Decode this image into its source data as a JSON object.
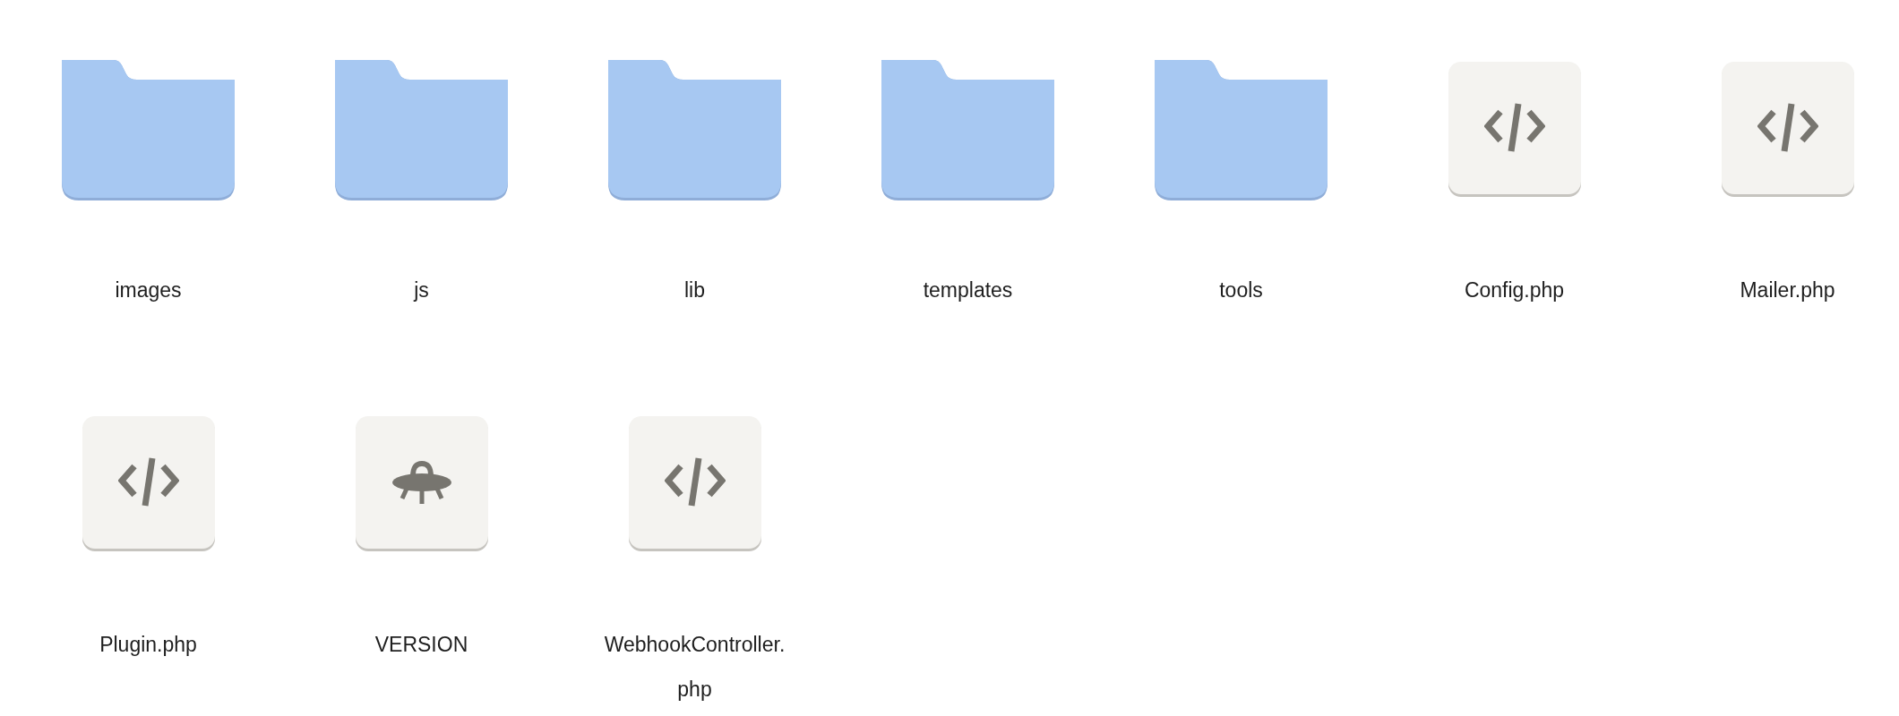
{
  "items": [
    {
      "kind": "folder",
      "name": "images"
    },
    {
      "kind": "folder",
      "name": "js"
    },
    {
      "kind": "folder",
      "name": "lib"
    },
    {
      "kind": "folder",
      "name": "templates"
    },
    {
      "kind": "folder",
      "name": "tools"
    },
    {
      "kind": "code",
      "name": "Config.php"
    },
    {
      "kind": "code",
      "name": "Mailer.php"
    },
    {
      "kind": "code",
      "name": "Plugin.php"
    },
    {
      "kind": "other",
      "name": "VERSION"
    },
    {
      "kind": "code",
      "name": "WebhookController.php"
    }
  ]
}
